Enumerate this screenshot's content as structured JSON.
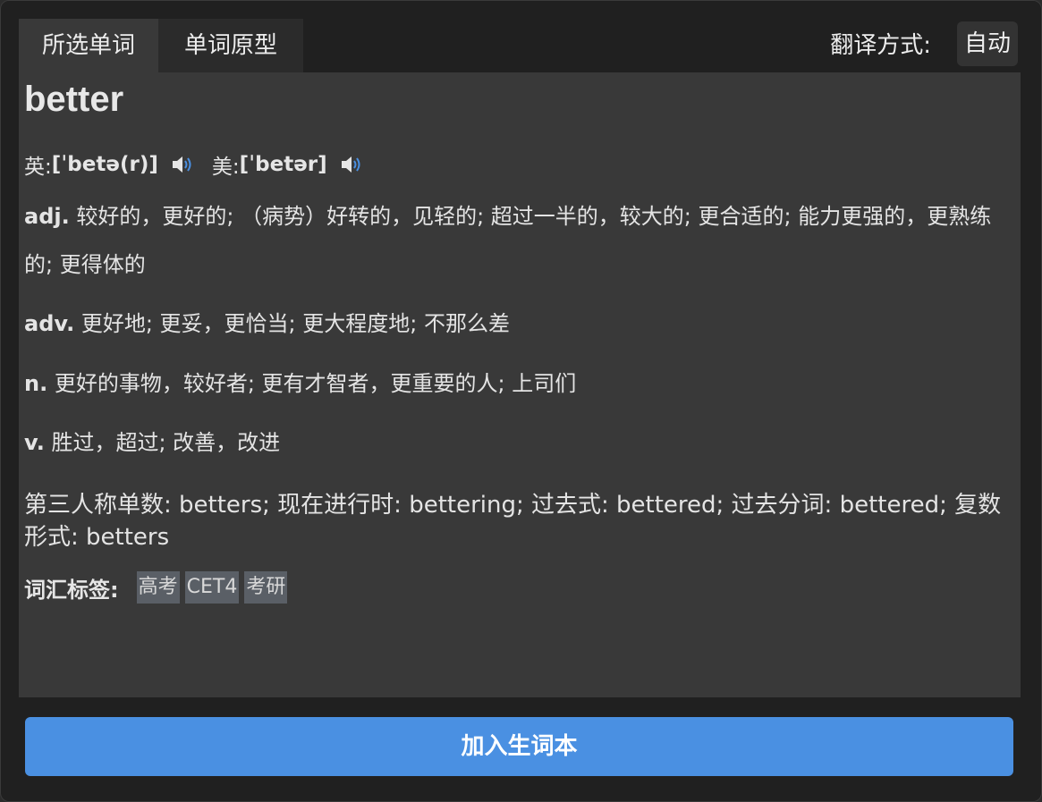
{
  "tabs": [
    {
      "label": "所选单词",
      "active": true
    },
    {
      "label": "单词原型",
      "active": false
    }
  ],
  "translate_mode": {
    "label": "翻译方式:",
    "value": "自动"
  },
  "entry": {
    "word": "better",
    "phonetics": {
      "uk_label": "英:",
      "uk_ipa": "[ˈbetə(r)]",
      "us_label": "美:",
      "us_ipa": "[ˈbetər]"
    },
    "definitions": [
      {
        "pos": "adj.",
        "text": "较好的，更好的; （病势）好转的，见轻的; 超过一半的，较大的; 更合适的; 能力更强的，更熟练的; 更得体的"
      },
      {
        "pos": "adv.",
        "text": "更好地; 更妥，更恰当; 更大程度地; 不那么差"
      },
      {
        "pos": "n.",
        "text": "更好的事物，较好者; 更有才智者，更重要的人; 上司们"
      },
      {
        "pos": "v.",
        "text": "胜过，超过; 改善，改进"
      }
    ],
    "forms": "第三人称单数: betters; 现在进行时: bettering; 过去式: bettered; 过去分词: bettered; 复数形式: betters",
    "tags_label": "词汇标签:",
    "tags": [
      "高考",
      "CET4",
      "考研"
    ]
  },
  "add_button": "加入生词本",
  "colors": {
    "accent": "#4a90e2",
    "panel": "#393939",
    "tag_bg": "#5a5f66"
  },
  "icons": {
    "speaker": "speaker-icon"
  }
}
